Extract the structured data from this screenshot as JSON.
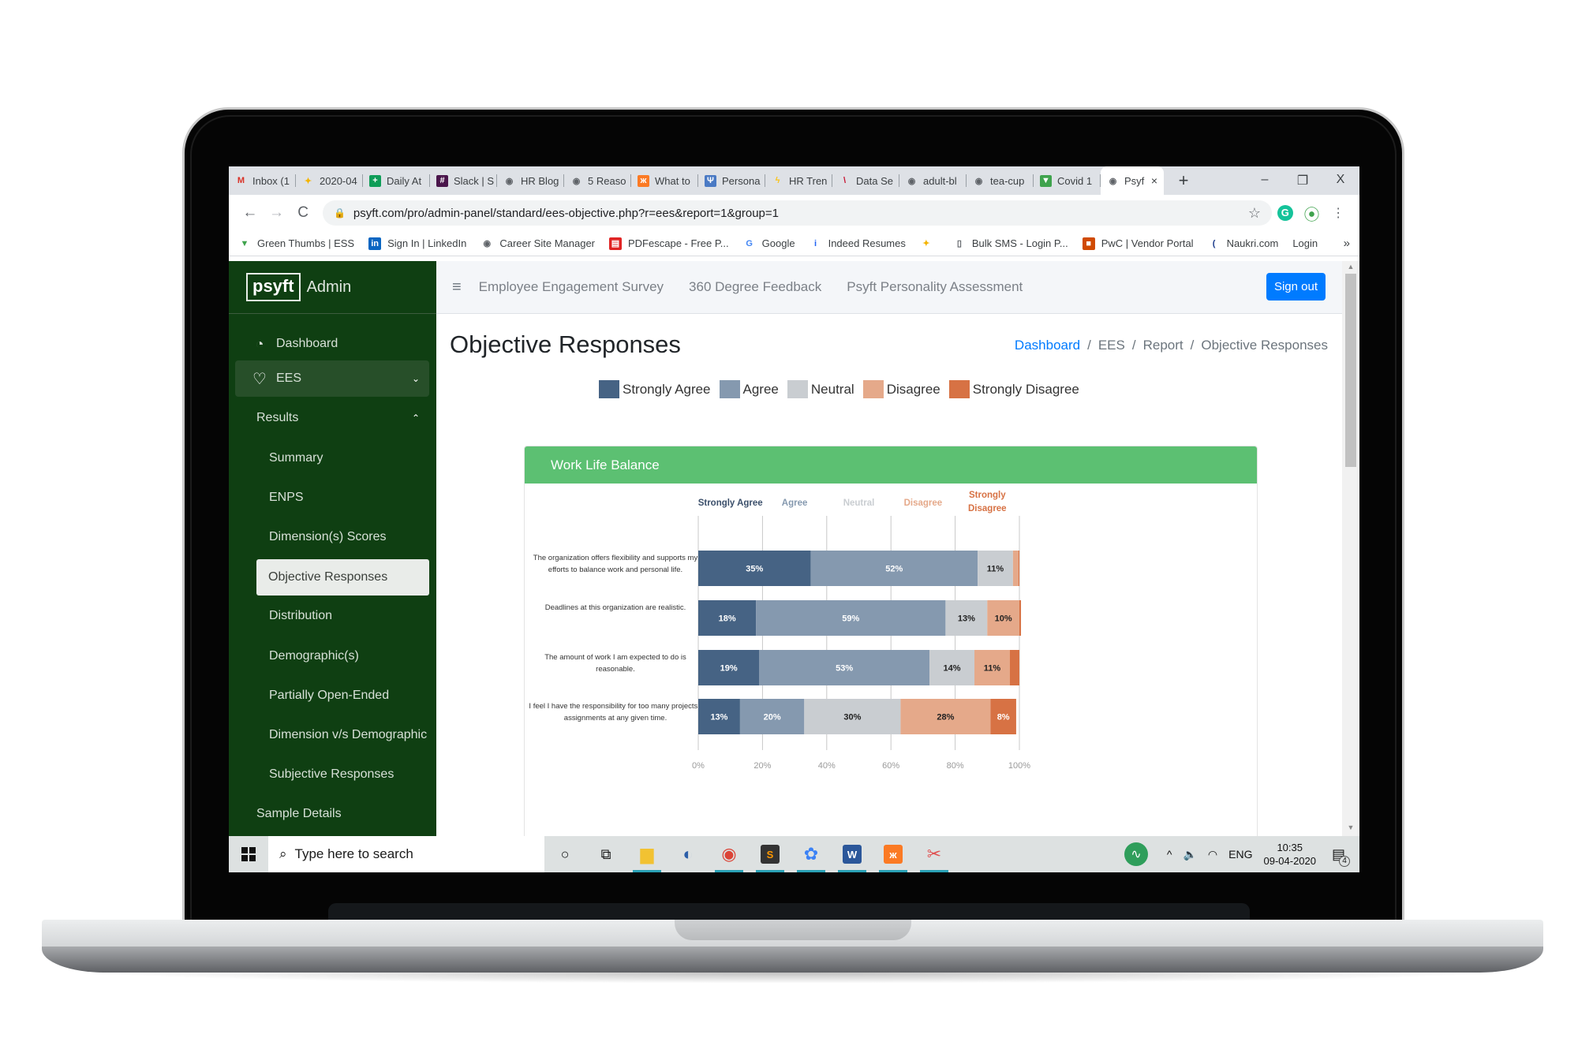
{
  "browser": {
    "tabs": [
      {
        "label": "Inbox (1",
        "icon": "gmail-icon",
        "color": "#d93025",
        "glyph": "M"
      },
      {
        "label": "2020-04",
        "icon": "photos-icon",
        "color": "#f4b400",
        "glyph": "✦"
      },
      {
        "label": "Daily At",
        "icon": "sheets-icon",
        "color": "#0f9d58",
        "glyph": "+"
      },
      {
        "label": "Slack | S",
        "icon": "slack-icon",
        "color": "#4a154b",
        "glyph": "#"
      },
      {
        "label": "HR Blog",
        "icon": "globe-icon",
        "color": "#5f6368",
        "glyph": "◉"
      },
      {
        "label": "5 Reaso",
        "icon": "globe-icon",
        "color": "#5f6368",
        "glyph": "◉"
      },
      {
        "label": "What to",
        "icon": "xampp-icon",
        "color": "#fb7a24",
        "glyph": "ж"
      },
      {
        "label": "Persona",
        "icon": "psi-icon",
        "color": "#4a7ac4",
        "glyph": "Ψ"
      },
      {
        "label": "HR Tren",
        "icon": "bolt-icon",
        "color": "#f9c31a",
        "glyph": "ϟ"
      },
      {
        "label": "Data Se",
        "icon": "stripes-icon",
        "color": "#c8102e",
        "glyph": "\\"
      },
      {
        "label": "adult-bl",
        "icon": "globe-icon",
        "color": "#5f6368",
        "glyph": "◉"
      },
      {
        "label": "tea-cup",
        "icon": "globe-icon",
        "color": "#5f6368",
        "glyph": "◉"
      },
      {
        "label": "Covid 1",
        "icon": "shield-icon",
        "color": "#3fa34d",
        "glyph": "▼"
      }
    ],
    "active_tab": {
      "label": "Psyf",
      "icon": "globe-icon",
      "close": "×"
    },
    "new_tab": "+",
    "window_controls": {
      "minimize": "–",
      "restore": "❐",
      "close": "X"
    },
    "nav": {
      "back": "←",
      "forward": "→",
      "reload": "C"
    },
    "url": "psyft.com/pro/admin-panel/standard/ees-objective.php?r=ees&report=1&group=1",
    "bookmarks": [
      {
        "label": "Green Thumbs | ESS",
        "icon": "shield-icon",
        "color": "#3fa34d",
        "glyph": "▼"
      },
      {
        "label": "Sign In | LinkedIn",
        "icon": "linkedin-icon",
        "color": "#0a66c2",
        "glyph": "in"
      },
      {
        "label": "Career Site Manager",
        "icon": "globe-icon",
        "color": "#5f6368",
        "glyph": "◉"
      },
      {
        "label": "PDFescape - Free P...",
        "icon": "pdf-icon",
        "color": "#e02424",
        "glyph": "▤"
      },
      {
        "label": "Google",
        "icon": "google-icon",
        "color": "#4285f4",
        "glyph": "G"
      },
      {
        "label": "Indeed Resumes",
        "icon": "indeed-icon",
        "color": "#2164f3",
        "glyph": "i"
      },
      {
        "label": "",
        "icon": "pinwheel-icon",
        "color": "#f4b400",
        "glyph": "✦"
      },
      {
        "label": "Bulk SMS - Login P...",
        "icon": "phone-icon",
        "color": "#5f6368",
        "glyph": "▯"
      },
      {
        "label": "PwC | Vendor Portal",
        "icon": "pwc-icon",
        "color": "#d04a02",
        "glyph": "■"
      },
      {
        "label": "Naukri.com",
        "icon": "naukri-icon",
        "color": "#1b3b8b",
        "glyph": "("
      },
      {
        "label": "Login",
        "icon": "",
        "color": "",
        "glyph": ""
      }
    ],
    "bookmarks_more": "»"
  },
  "sidebar": {
    "brand_logo": "psyft",
    "brand_text": "Admin",
    "items": [
      {
        "label": "Dashboard",
        "icon": "dashboard-icon",
        "glyph": "◔"
      },
      {
        "label": "EES",
        "icon": "heart-icon",
        "glyph": "♡",
        "chevron": "⌄"
      },
      {
        "label": "Results",
        "chevron": "⌃"
      },
      {
        "label": "Summary"
      },
      {
        "label": "ENPS"
      },
      {
        "label": "Dimension(s) Scores"
      },
      {
        "label": "Objective Responses"
      },
      {
        "label": "Distribution"
      },
      {
        "label": "Demographic(s)"
      },
      {
        "label": "Partially Open-Ended"
      },
      {
        "label": "Dimension v/s Demographic"
      },
      {
        "label": "Subjective Responses"
      },
      {
        "label": "Sample Details"
      }
    ]
  },
  "topbar": {
    "menu_icon": "≡",
    "links": [
      "Employee Engagement Survey",
      "360 Degree Feedback",
      "Psyft Personality Assessment"
    ],
    "signout": "Sign out"
  },
  "page": {
    "title": "Objective Responses",
    "breadcrumb": [
      "Dashboard",
      "EES",
      "Report",
      "Objective Responses"
    ],
    "breadcrumb_sep": "/"
  },
  "legend": [
    {
      "label": "Strongly Agree",
      "color": "#466384"
    },
    {
      "label": "Agree",
      "color": "#8599af"
    },
    {
      "label": "Neutral",
      "color": "#c9cdd1"
    },
    {
      "label": "Disagree",
      "color": "#e5a98a"
    },
    {
      "label": "Strongly Disagree",
      "color": "#d77244"
    }
  ],
  "panel": {
    "title": "Work Life Balance",
    "header_color": "#5cc072"
  },
  "chart_data": {
    "type": "bar",
    "orientation": "horizontal-stacked-100",
    "title": "Work Life Balance",
    "categories": [
      [
        "The organization offers flexibility and supports my",
        "efforts to balance work and personal life."
      ],
      [
        "Deadlines at this organization are realistic."
      ],
      [
        "The amount of work I am expected to do is",
        "reasonable."
      ],
      [
        "I feel I have the responsibility for too many projects /",
        "assignments at any given time."
      ]
    ],
    "series": [
      {
        "name": "Strongly Agree",
        "color": "#466384",
        "label_color": "#ffffff",
        "values": [
          35,
          18,
          19,
          13
        ],
        "labels": [
          "35%",
          "18%",
          "19%",
          "13%"
        ]
      },
      {
        "name": "Agree",
        "color": "#8599af",
        "label_color": "#ffffff",
        "values": [
          52,
          59,
          53,
          20
        ],
        "labels": [
          "52%",
          "59%",
          "53%",
          "20%"
        ]
      },
      {
        "name": "Neutral",
        "color": "#c9cdd1",
        "label_color": "#222222",
        "values": [
          11,
          13,
          14,
          30
        ],
        "labels": [
          "11%",
          "13%",
          "14%",
          "30%"
        ]
      },
      {
        "name": "Disagree",
        "color": "#e5a98a",
        "label_color": "#222222",
        "values": [
          1.7,
          10,
          11,
          28
        ],
        "labels": [
          "",
          "10%",
          "11%",
          "28%"
        ]
      },
      {
        "name": "Strongly Disagree",
        "color": "#d77244",
        "label_color": "#ffffff",
        "values": [
          0.3,
          0.5,
          3,
          8
        ],
        "labels": [
          "",
          "",
          "",
          "8%"
        ]
      }
    ],
    "column_headers": [
      {
        "label": [
          "Strongly Agree"
        ],
        "color": "#3b4f6b"
      },
      {
        "label": [
          "Agree"
        ],
        "color": "#8599af"
      },
      {
        "label": [
          "Neutral"
        ],
        "color": "#c9cdd1"
      },
      {
        "label": [
          "Disagree"
        ],
        "color": "#e5a98a"
      },
      {
        "label": [
          "Strongly",
          "Disagree"
        ],
        "color": "#d77244"
      }
    ],
    "x_ticks": [
      "0%",
      "20%",
      "40%",
      "60%",
      "80%",
      "100%"
    ],
    "xlim": [
      0,
      100
    ],
    "grid": true,
    "legend": "top-center"
  },
  "taskbar": {
    "start_icon": "windows-icon",
    "search_placeholder": "Type here to search",
    "apps": [
      {
        "name": "cortana-icon",
        "glyph": "○",
        "running": false,
        "color": ""
      },
      {
        "name": "task-view-icon",
        "glyph": "⧉",
        "running": false,
        "color": ""
      },
      {
        "name": "file-explorer-icon",
        "glyph": "▆",
        "running": true,
        "color": "#f2c232"
      },
      {
        "name": "media-icon",
        "glyph": "◐",
        "running": false,
        "color": "#2b5ea8"
      },
      {
        "name": "chrome-icon",
        "glyph": "◉",
        "running": true,
        "color": "#db4437"
      },
      {
        "name": "sublime-icon",
        "glyph": "S",
        "running": true,
        "color": "#ff9800"
      },
      {
        "name": "app-icon",
        "glyph": "✿",
        "running": true,
        "color": "#3b82f6"
      },
      {
        "name": "word-icon",
        "glyph": "W",
        "running": true,
        "color": "#2b579a"
      },
      {
        "name": "xampp-icon",
        "glyph": "ж",
        "running": true,
        "color": "#fb7a24"
      },
      {
        "name": "snipping-tool-icon",
        "glyph": "✂",
        "running": true,
        "color": "#e05050"
      }
    ],
    "tray": {
      "activity_icon": "∿",
      "overflow": "^",
      "volume": "🔈",
      "wifi": "◠",
      "language": "ENG",
      "time": "10:35",
      "date": "09-04-2020",
      "notifications_count": "4"
    }
  }
}
